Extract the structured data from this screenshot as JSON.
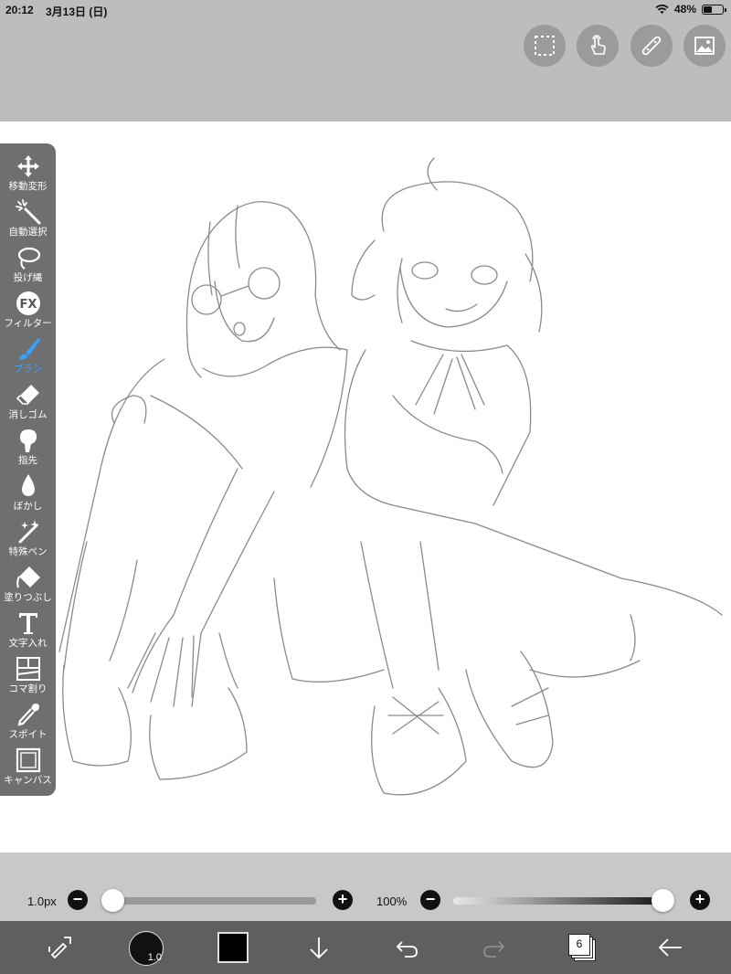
{
  "status_bar": {
    "time": "20:12",
    "date": "3月13日 (日)",
    "battery_percent": "48%",
    "battery_level": 0.48,
    "wifi_icon": "wifi-icon"
  },
  "top_buttons": [
    {
      "name": "selection-icon"
    },
    {
      "name": "touch-icon"
    },
    {
      "name": "ruler-icon"
    },
    {
      "name": "image-icon"
    }
  ],
  "tools": [
    {
      "label": "移動変形",
      "icon": "move-icon",
      "active": false
    },
    {
      "label": "自動選択",
      "icon": "magic-wand-icon",
      "active": false
    },
    {
      "label": "投げ縄",
      "icon": "lasso-icon",
      "active": false
    },
    {
      "label": "フィルター",
      "icon": "fx-icon",
      "active": false
    },
    {
      "label": "ブラシ",
      "icon": "brush-icon",
      "active": true
    },
    {
      "label": "消しゴム",
      "icon": "eraser-icon",
      "active": false
    },
    {
      "label": "指先",
      "icon": "finger-icon",
      "active": false
    },
    {
      "label": "ぼかし",
      "icon": "blur-drop-icon",
      "active": false
    },
    {
      "label": "特殊ペン",
      "icon": "sparkle-pen-icon",
      "active": false
    },
    {
      "label": "塗りつぶし",
      "icon": "bucket-icon",
      "active": false
    },
    {
      "label": "文字入れ",
      "icon": "text-icon",
      "active": false
    },
    {
      "label": "コマ割り",
      "icon": "frame-divider-icon",
      "active": false
    },
    {
      "label": "スポイト",
      "icon": "eyedropper-icon",
      "active": false
    },
    {
      "label": "キャンバス",
      "icon": "canvas-icon",
      "active": false
    }
  ],
  "brush_size": {
    "label": "1.0px",
    "value_fraction": 0.0,
    "minus": "−",
    "plus": "+"
  },
  "opacity": {
    "label": "100%",
    "value_fraction": 1.0,
    "minus": "−",
    "plus": "+"
  },
  "bottom_bar": {
    "brush_size_label": "1.0",
    "layer_count": "6",
    "active_color": "#000000"
  },
  "colors": {
    "accent": "#3aa0ff",
    "toolbar_bg": "#6f6f6f",
    "chrome_bg": "#bdbdbd"
  }
}
